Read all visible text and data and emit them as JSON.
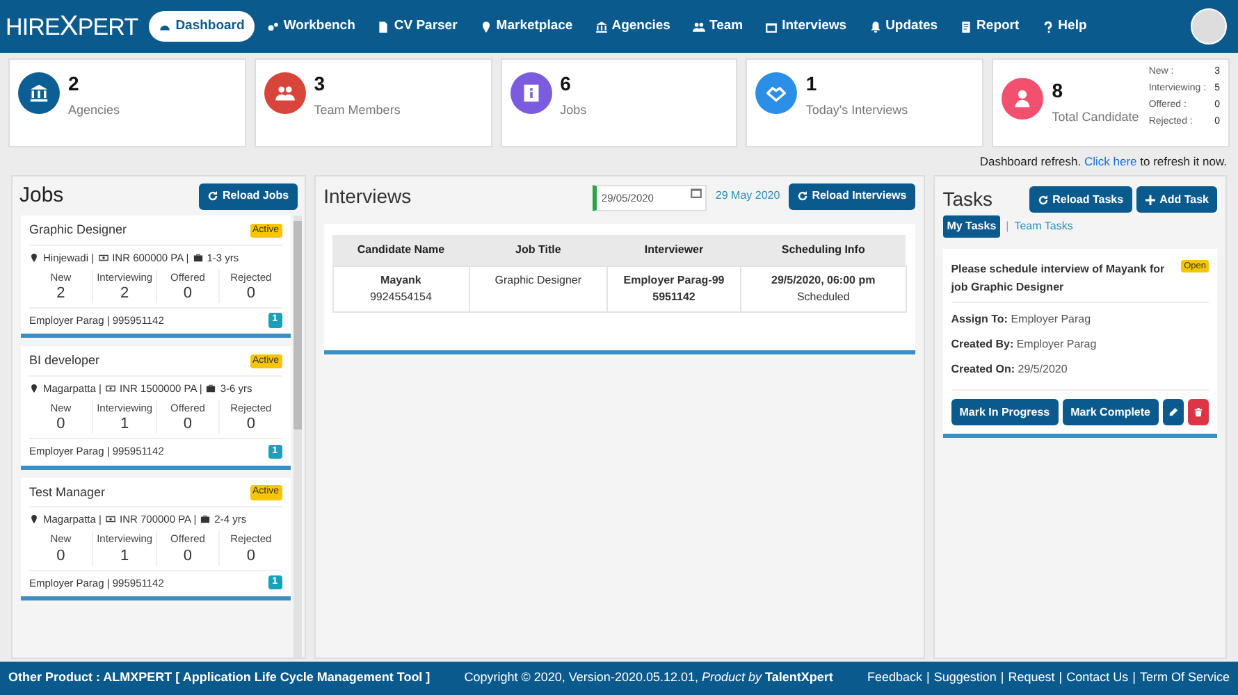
{
  "nav": {
    "logo_left": "HIRE",
    "logo_mark": "X",
    "logo_right": "PERT",
    "items": [
      {
        "label": "Dashboard",
        "selected": true
      },
      {
        "label": "Workbench",
        "selected": false
      },
      {
        "label": "CV Parser",
        "selected": false
      },
      {
        "label": "Marketplace",
        "selected": false
      },
      {
        "label": "Agencies",
        "selected": false
      },
      {
        "label": "Team",
        "selected": false
      },
      {
        "label": "Interviews",
        "selected": false
      },
      {
        "label": "Updates",
        "selected": false
      },
      {
        "label": "Report",
        "selected": false
      },
      {
        "label": "Help",
        "selected": false
      }
    ]
  },
  "stats": [
    {
      "value": "2",
      "label": "Agencies",
      "color": "#0b5f94"
    },
    {
      "value": "3",
      "label": "Team Members",
      "color": "#d8453b"
    },
    {
      "value": "6",
      "label": "Jobs",
      "color": "#7b5ce0"
    },
    {
      "value": "1",
      "label": "Today's Interviews",
      "color": "#2b8fe8"
    },
    {
      "value": "8",
      "label": "Total Candidate",
      "color": "#f2506e",
      "breakdown": [
        {
          "label": "New :",
          "value": "3"
        },
        {
          "label": "Interviewing :",
          "value": "5"
        },
        {
          "label": "Offered :",
          "value": "0"
        },
        {
          "label": "Rejected :",
          "value": "0"
        }
      ]
    }
  ],
  "refresh": {
    "text": "Dashboard refresh.",
    "link": "Click here",
    "after": "to refresh it now."
  },
  "jobs": {
    "title": "Jobs",
    "button": "Reload Jobs",
    "items": [
      {
        "title": "Graphic Designer",
        "status": "Active",
        "location": "Hinjewadi |",
        "salary": "INR 600000 PA |",
        "experience": "1-3 yrs",
        "counts": [
          {
            "label": "New",
            "value": "2"
          },
          {
            "label": "Interviewing",
            "value": "2"
          },
          {
            "label": "Offered",
            "value": "0"
          },
          {
            "label": "Rejected",
            "value": "0"
          }
        ],
        "contact": "Employer Parag | 995951142",
        "badge": "1"
      },
      {
        "title": "BI developer",
        "status": "Active",
        "location": "Magarpatta |",
        "salary": "INR 1500000 PA |",
        "experience": "3-6 yrs",
        "counts": [
          {
            "label": "New",
            "value": "0"
          },
          {
            "label": "Interviewing",
            "value": "1"
          },
          {
            "label": "Offered",
            "value": "0"
          },
          {
            "label": "Rejected",
            "value": "0"
          }
        ],
        "contact": "Employer Parag | 995951142",
        "badge": "1"
      },
      {
        "title": "Test Manager",
        "status": "Active",
        "location": "Magarpatta |",
        "salary": "INR 700000 PA |",
        "experience": "2-4 yrs",
        "counts": [
          {
            "label": "New",
            "value": "0"
          },
          {
            "label": "Interviewing",
            "value": "1"
          },
          {
            "label": "Offered",
            "value": "0"
          },
          {
            "label": "Rejected",
            "value": "0"
          }
        ],
        "contact": "Employer Parag | 995951142",
        "badge": "1"
      }
    ]
  },
  "interviews": {
    "title": "Interviews",
    "date_value": "29/05/2020",
    "date_label": "29 May 2020",
    "button": "Reload Interviews",
    "columns": [
      "Candidate Name",
      "Job Title",
      "Interviewer",
      "Scheduling Info"
    ],
    "rows": [
      {
        "name": "Mayank",
        "phone": "9924554154",
        "job": "Graphic Designer",
        "interviewer": "Employer Parag-99 5951142",
        "time": "29/5/2020, 06:00 pm",
        "status": "Scheduled"
      }
    ]
  },
  "tasks": {
    "title": "Tasks",
    "buttons": [
      "Reload Tasks",
      "Add Task"
    ],
    "tabs": [
      {
        "label": "My Tasks",
        "selected": true
      },
      {
        "label": "Team Tasks",
        "selected": false
      }
    ],
    "tab_separator": "|",
    "items": [
      {
        "text": "Please schedule interview of Mayank for job Graphic Designer",
        "status": "Open",
        "details": [
          "**Assign To:** Employer Parag",
          "**Created By:** Employer Parag",
          "**Created On:** 29/5/2020"
        ],
        "actions": [
          "Mark In Progress",
          "Mark Complete"
        ]
      }
    ]
  },
  "footer": {
    "other": "Other Product : ALMXPERT [ Application Life Cycle Management Tool ]",
    "copyright": "Copyright © 2020, Version-2020.05.12.01, *Product by* **TalentXpert**",
    "links": [
      "Feedback",
      "Suggestion",
      "Request",
      "Contact Us",
      "Term Of Service"
    ],
    "separator": "|"
  }
}
